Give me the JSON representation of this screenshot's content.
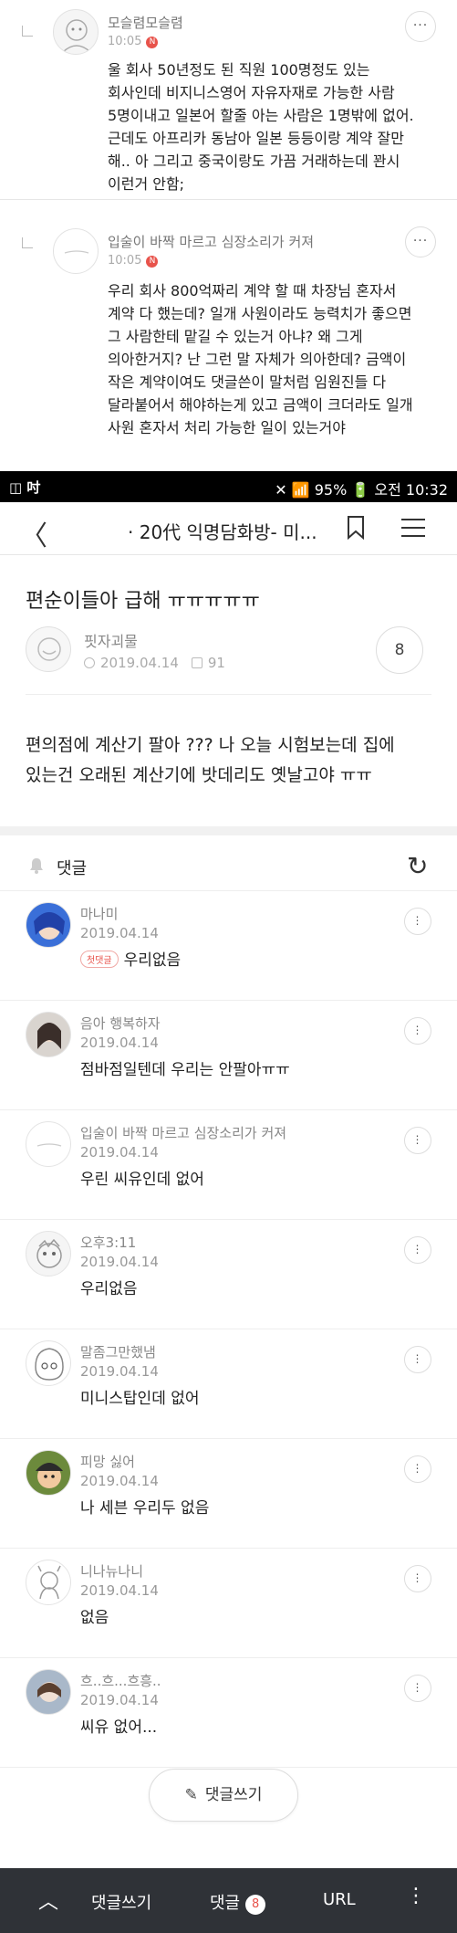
{
  "top_replies": [
    {
      "name": "모슬렴모슬렴",
      "time": "10:05",
      "new_badge": "N",
      "text": "울 회사 50년정도 된 직원 100명정도 있는 회사인데 비지니스영어 자유자재로 가능한 사람 5명이내고 일본어 할줄 아는 사람은 1명밖에 없어. 근데도 아프리카 동남아 일본 등등이랑 계약 잘만 해.. 아 그리고 중국이랑도 가끔 거래하는데 꽌시 이런거 안함;"
    },
    {
      "name": "입술이 바짝 마르고 심장소리가 커져",
      "time": "10:05",
      "new_badge": "N",
      "text": "우리 회사 800억짜리 계약 할 때 차장님 혼자서 계약 다 했는데? 일개 사원이라도 능력치가 좋으면 그 사람한테 맡길 수 있는거 아냐? 왜 그게 의아한거지? 난 그런 말 자체가 의아한데? 금액이 작은 계약이여도 댓글쓴이 말처럼 임원진들 다 달라붙어서 해야하는게 있고 금액이 크더라도 일개 사원 혼자서 처리 가능한 일이 있는거야"
    }
  ],
  "more_label": "···",
  "status_bar": {
    "left_icons": "◫ 吋",
    "right": "✕ 📶 95% 🔋 오전 10:32"
  },
  "nav": {
    "back": "〈",
    "title": "· 20代 익명담화방- 미..."
  },
  "post": {
    "title": "편순이들아 급해 ㅠㅠㅠㅠㅠ",
    "author": "핏자괴물",
    "date": "2019.04.14",
    "views": "91",
    "comment_count": "8",
    "body": "편의점에 계산기 팔아 ??? 나 오늘 시험보는데 집에 있는건 오래된 계산기에 밧데리도 옛날고야 ㅠㅠ"
  },
  "comments_header": {
    "label": "댓글",
    "refresh": "↻"
  },
  "comments": [
    {
      "name": "마나미",
      "date": "2019.04.14",
      "badge": "첫댓글",
      "text": "우리없음"
    },
    {
      "name": "음아 행복하자",
      "date": "2019.04.14",
      "badge": "",
      "text": "점바점일텐데 우리는 안팔아ㅠㅠ"
    },
    {
      "name": "입술이 바짝 마르고 심장소리가 커져",
      "date": "2019.04.14",
      "badge": "",
      "text": "우린 씨유인데 없어"
    },
    {
      "name": "오후3:11",
      "date": "2019.04.14",
      "badge": "",
      "text": "우리없음"
    },
    {
      "name": "말좀그만했냄",
      "date": "2019.04.14",
      "badge": "",
      "text": "미니스탑인데 없어"
    },
    {
      "name": "피망 싫어",
      "date": "2019.04.14",
      "badge": "",
      "text": "나 세븐 우리두 없음"
    },
    {
      "name": "니나뉴나니",
      "date": "2019.04.14",
      "badge": "",
      "text": "없음"
    },
    {
      "name": "흐..흐...흐흥..",
      "date": "2019.04.14",
      "badge": "",
      "text": "씨유 없어..."
    }
  ],
  "write_button": {
    "icon": "✎",
    "label": "댓글쓰기"
  },
  "bottom_bar": {
    "up": "︿",
    "write": "댓글쓰기",
    "comments": "댓글",
    "comments_count": "8",
    "url": "URL",
    "more": "⋮"
  },
  "colors": {
    "accent_red": "#e8534b",
    "bottom_bar_bg": "#2f3237"
  }
}
